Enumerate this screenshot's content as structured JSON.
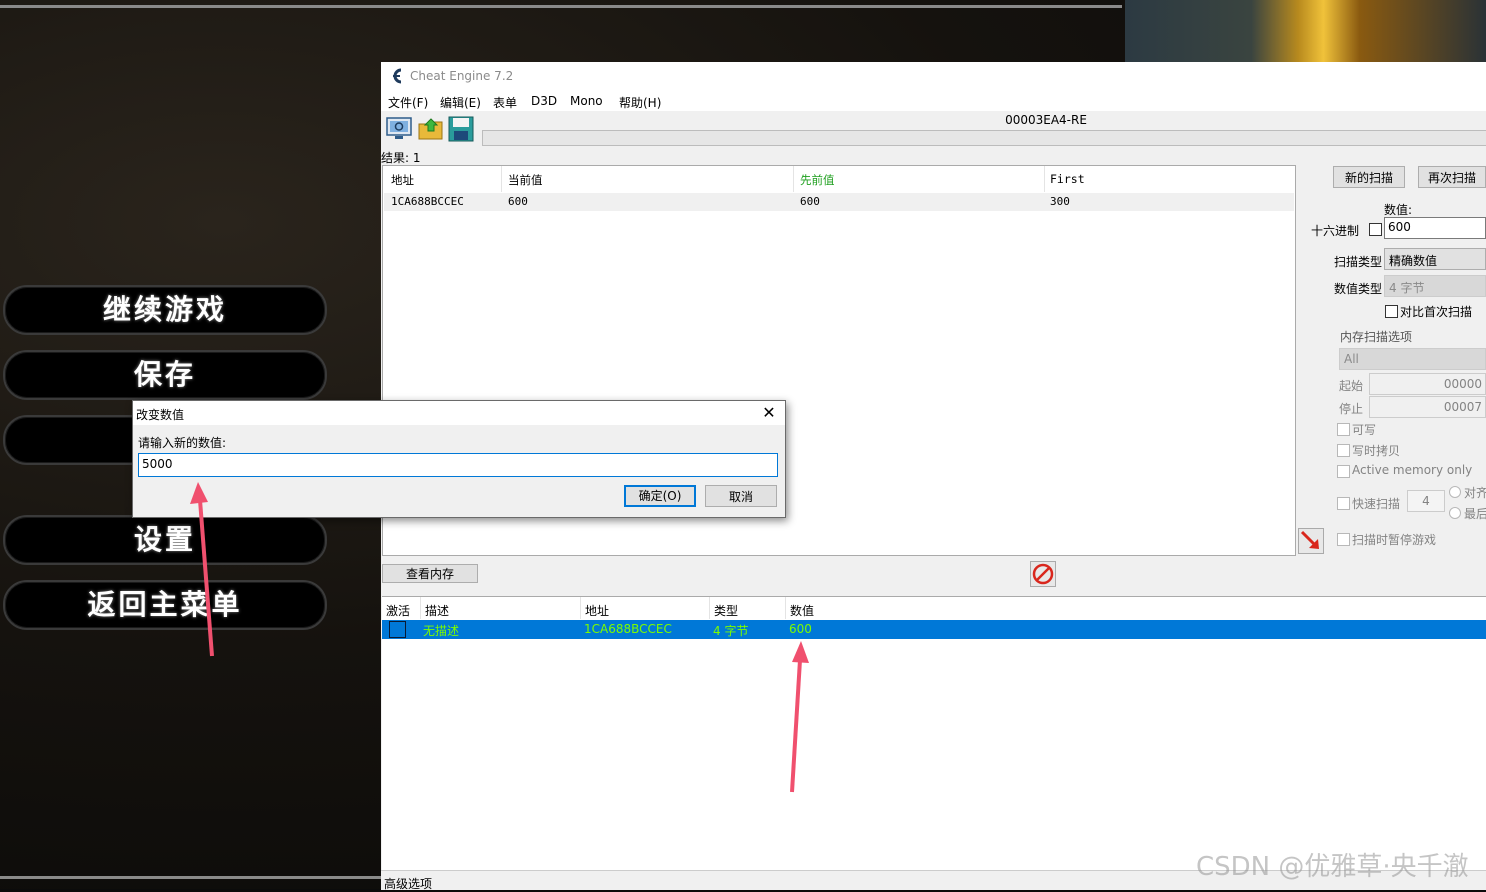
{
  "game": {
    "menu": [
      "继续游戏",
      "保存",
      "",
      "设置",
      "返回主菜单"
    ]
  },
  "ce": {
    "title": "Cheat Engine 7.2",
    "menu": [
      "文件(F)",
      "编辑(E)",
      "表单",
      "D3D",
      "Mono",
      "帮助(H)"
    ],
    "process": "00003EA4-RE",
    "found": "结果: 1",
    "results": {
      "headers": [
        "地址",
        "当前值",
        "先前值",
        "First"
      ],
      "row": [
        "1CA688BCCEC",
        "600",
        "600",
        "300"
      ]
    },
    "scan": {
      "new_scan": "新的扫描",
      "next_scan": "再次扫描",
      "value_label": "数值:",
      "hex_label": "十六进制",
      "value": "600",
      "scan_type_label": "扫描类型",
      "scan_type": "精确数值",
      "value_type_label": "数值类型",
      "value_type": "4 字节",
      "compare_first": "对比首次扫描",
      "mem_options_title": "内存扫描选项",
      "mem_region": "All",
      "start_label": "起始",
      "start_value": "00000",
      "stop_label": "停止",
      "stop_value": "00007",
      "writable": "可写",
      "copy_on_write": "写时拷贝",
      "active_memory": "Active memory only",
      "fast_scan": "快速扫描",
      "fast_scan_value": "4",
      "align": "对齐",
      "last": "最后",
      "pause_game": "扫描时暂停游戏"
    },
    "view_memory": "查看内存",
    "address_list": {
      "headers": [
        "激活",
        "描述",
        "地址",
        "类型",
        "数值"
      ],
      "row": [
        "无描述",
        "1CA688BCCEC",
        "4 字节",
        "600"
      ]
    },
    "advanced": "高级选项"
  },
  "dialog": {
    "title": "改变数值",
    "prompt": "请输入新的数值:",
    "value": "5000",
    "ok": "确定(O)",
    "cancel": "取消"
  },
  "watermark": "CSDN @优雅草·央千澈",
  "colors": {
    "selection": "#0078d7",
    "green_text": "#7cfc00",
    "arrow": "#f0506e"
  }
}
